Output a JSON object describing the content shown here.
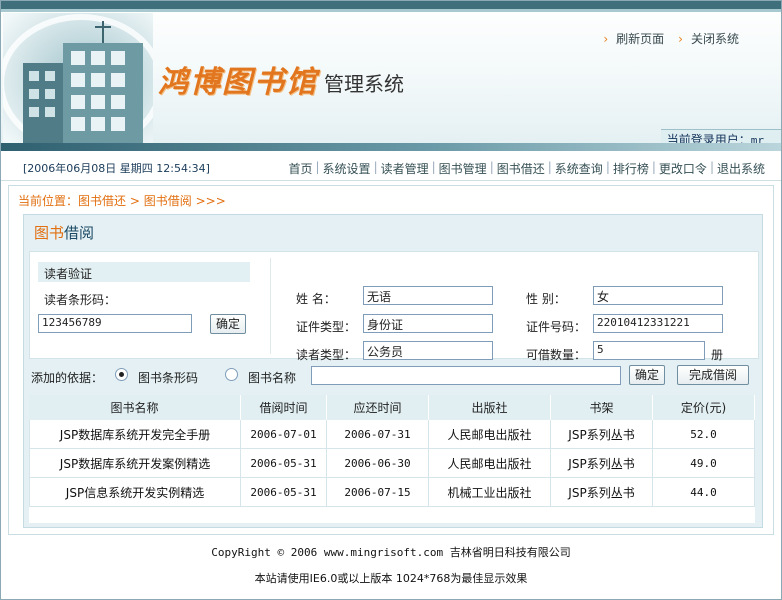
{
  "header": {
    "logo_main": "鸿博图书馆",
    "logo_sub": "管理系统",
    "links": [
      "刷新页面",
      "关闭系统"
    ],
    "current_user_label": "当前登录用户：",
    "current_user": "mr"
  },
  "nav": {
    "datetime": "[2006年06月08日 星期四 12:54:34]",
    "items": [
      "首页",
      "系统设置",
      "读者管理",
      "图书管理",
      "图书借还",
      "系统查询",
      "排行榜",
      "更改口令",
      "退出系统"
    ]
  },
  "breadcrumb": {
    "prefix": "当前位置：",
    "part1": "图书借还",
    "sep": ">",
    "part2": "图书借阅",
    "tail": ">>>"
  },
  "panel": {
    "title_a": "图书",
    "title_b": "借阅"
  },
  "reader": {
    "verify_label": "读者验证",
    "barcode_label": "读者条形码：",
    "barcode_value": "123456789",
    "confirm_label": "确定",
    "name_label": "姓    名：",
    "name": "无语",
    "gender_label": "性    别：",
    "gender": "女",
    "id_type_label": "证件类型：",
    "id_type": "身份证",
    "id_no_label": "证件号码：",
    "id_no": "22010412331221",
    "reader_type_label": "读者类型：",
    "reader_type": "公务员",
    "can_borrow_label": "可借数量：",
    "can_borrow": "5",
    "can_borrow_unit": "册"
  },
  "search": {
    "label": "添加的依据：",
    "opt1": "图书条形码",
    "opt2": "图书名称",
    "selected": "图书条形码",
    "confirm_label": "确定",
    "finish_label": "完成借阅"
  },
  "table": {
    "headers": [
      "图书名称",
      "借阅时间",
      "应还时间",
      "出版社",
      "书架",
      "定价(元)"
    ],
    "rows": [
      [
        "JSP数据库系统开发完全手册",
        "2006-07-01",
        "2006-07-31",
        "人民邮电出版社",
        "JSP系列丛书",
        "52.0"
      ],
      [
        "JSP数据库系统开发案例精选",
        "2006-05-31",
        "2006-06-30",
        "人民邮电出版社",
        "JSP系列丛书",
        "49.0"
      ],
      [
        "JSP信息系统开发实例精选",
        "2006-05-31",
        "2006-07-15",
        "机械工业出版社",
        "JSP系列丛书",
        "44.0"
      ]
    ]
  },
  "footer": {
    "line1": "CopyRight © 2006 www.mingrisoft.com 吉林省明日科技有限公司",
    "line2": "本站请使用IE6.0或以上版本 1024*768为最佳显示效果"
  }
}
